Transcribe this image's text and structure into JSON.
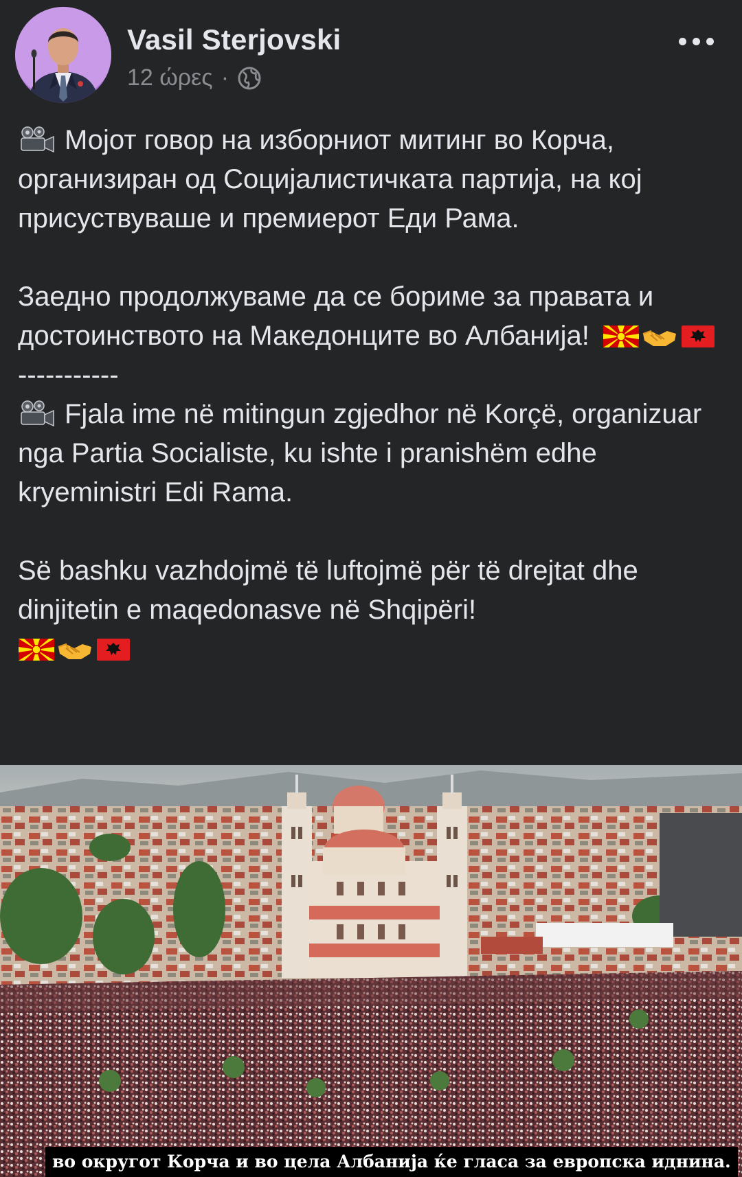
{
  "post": {
    "author": "Vasil Sterjovski",
    "time": "12 ώρες",
    "separator": "·",
    "privacy_icon": "globe-icon",
    "more_icon": "more-horizontal-icon"
  },
  "body": {
    "camera_icon": "movie-camera-icon",
    "mk_paragraph_1": "Мојот говор на изборниот митинг во Корча, организиран од Социјалистичката партија, на кој присуствуваше и премиерот Еди Рама.",
    "mk_paragraph_2": "Заедно продолжуваме да се бориме за правата и достоинството на Македонците во Албанија!",
    "divider": "-----------",
    "sq_paragraph_1": "Fjala ime në mitingun zgjedhor në Korçë, organizuar nga Partia Socialiste, ku ishte i pranishëm edhe kryeministri Edi Rama.",
    "sq_paragraph_2": "Së bashku vazhdojmë të luftojmë për të drejtat dhe dinjitetin e maqedonasve në Shqipëri!",
    "emojis": [
      "flag-north-macedonia",
      "handshake",
      "flag-albania"
    ]
  },
  "video": {
    "subtitle": "во округот Корча и во цела Албанија ќе гласа за европска иднина."
  },
  "colors": {
    "background": "#242526",
    "text": "#e4e6eb",
    "secondary_text": "#8a8d91"
  }
}
